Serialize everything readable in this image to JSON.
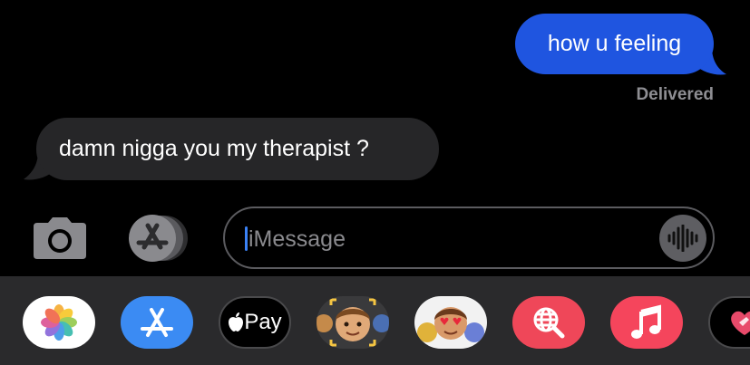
{
  "thread": {
    "outgoing_message": "how u feeling",
    "delivery_status": "Delivered",
    "incoming_message": "damn nigga you my therapist ?"
  },
  "composer": {
    "placeholder": "iMessage",
    "camera_icon": "camera-icon",
    "apps_icon": "app-store-icon",
    "audio_icon": "audio-waveform-icon"
  },
  "app_drawer": {
    "apps": [
      {
        "name": "Photos",
        "icon": "photos-icon"
      },
      {
        "name": "App Store",
        "icon": "app-store-icon"
      },
      {
        "name": "Apple Pay",
        "label": "Pay",
        "icon": "apple-logo-icon"
      },
      {
        "name": "Memoji",
        "icon": "memoji-icon"
      },
      {
        "name": "Memoji Stickers",
        "icon": "memoji-stickers-icon"
      },
      {
        "name": "Image Search",
        "icon": "globe-search-icon"
      },
      {
        "name": "Music",
        "icon": "music-note-icon"
      },
      {
        "name": "Digital Touch",
        "icon": "heart-hand-icon"
      }
    ]
  },
  "colors": {
    "outgoing_bubble": "#1f55e0",
    "incoming_bubble": "#262628",
    "background": "#000000",
    "drawer": "#2a2a2c",
    "status_text": "#8e8e93",
    "caret": "#3b82f6"
  }
}
